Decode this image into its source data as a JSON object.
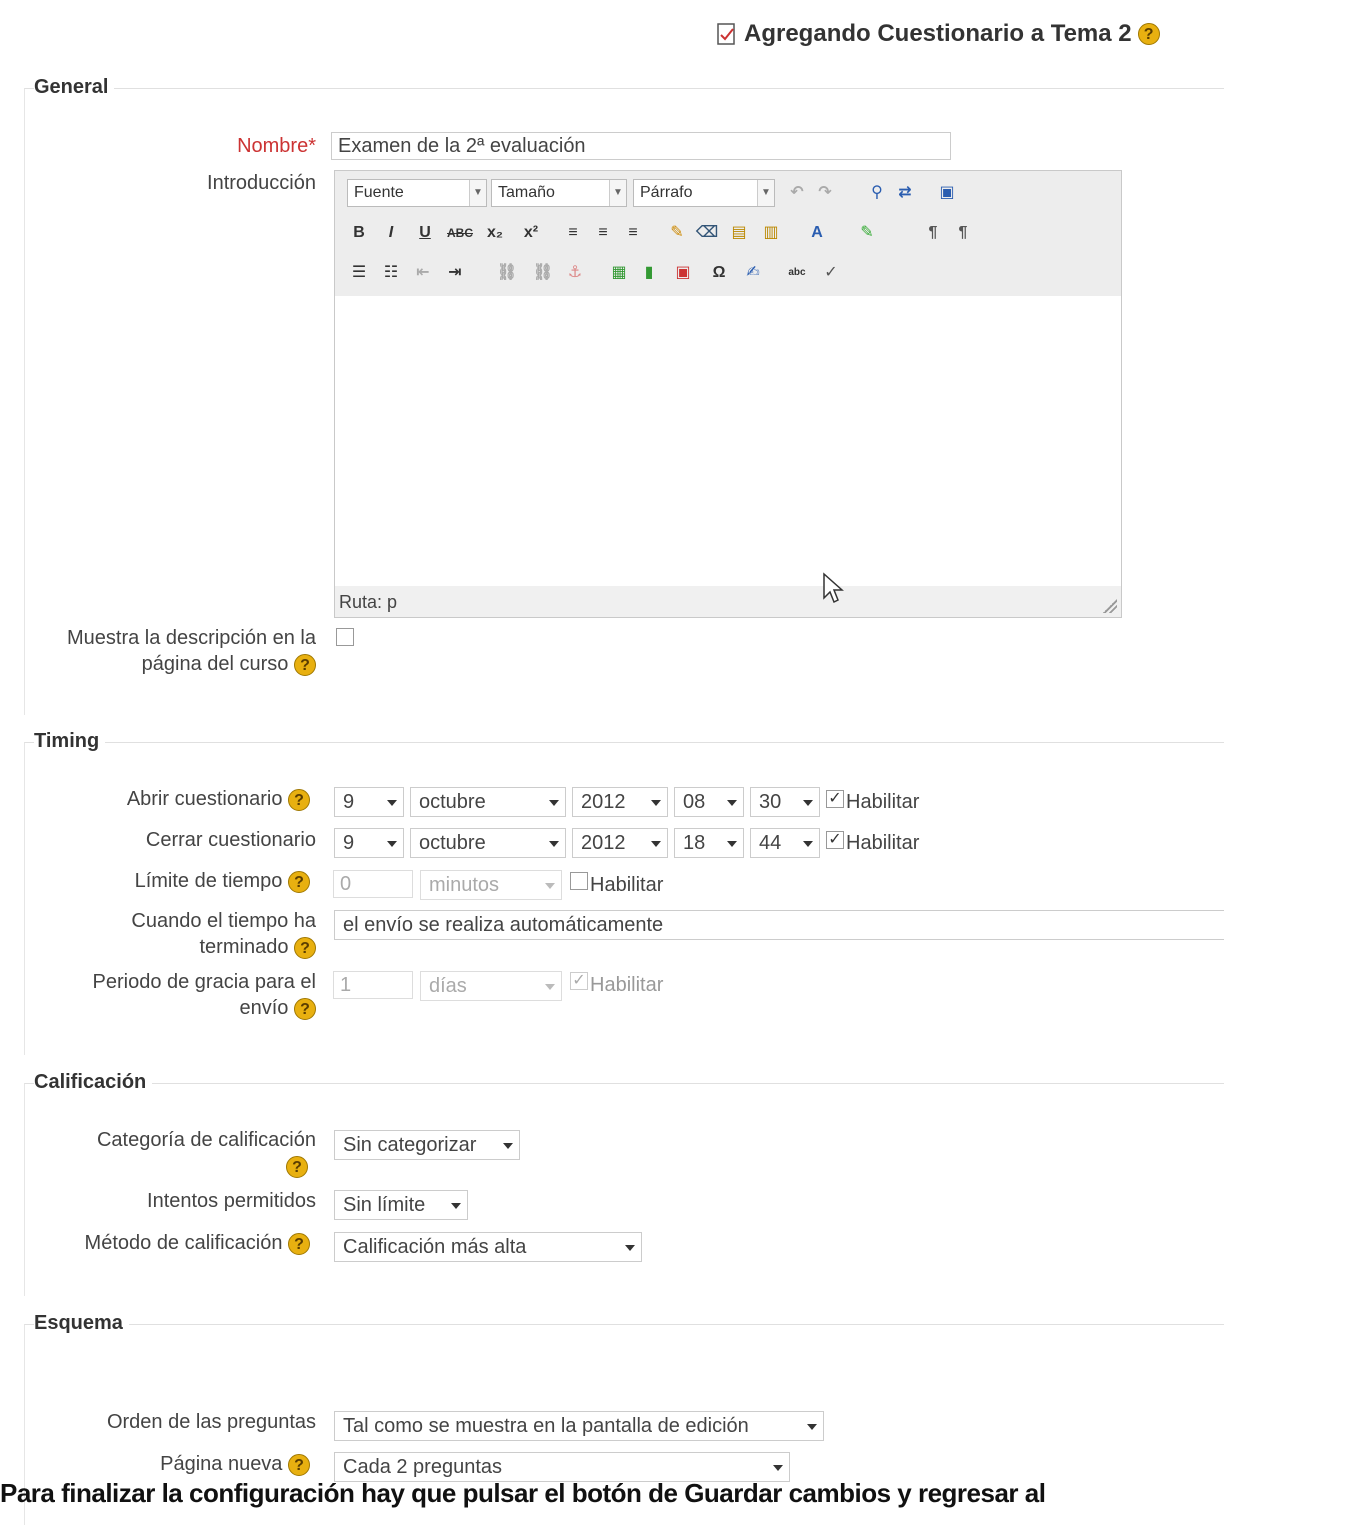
{
  "heading": {
    "icon": "quiz-icon",
    "text": "Agregando Cuestionario a Tema 2"
  },
  "general": {
    "legend": "General",
    "nombre": {
      "label": "Nombre",
      "required_mark": "*",
      "value": "Examen de la 2ª evaluación"
    },
    "introduccion": {
      "label": "Introducción",
      "font_select": "Fuente",
      "size_select": "Tamaño",
      "format_select": "Párrafo",
      "row2": [
        "B",
        "I",
        "U",
        "ABC",
        "x₂",
        "x²"
      ],
      "path_label": "Ruta: p"
    },
    "muestra": {
      "label": "Muestra la descripción en la página del curso",
      "checked": false
    }
  },
  "timing": {
    "legend": "Timing",
    "abrir": {
      "label": "Abrir cuestionario",
      "day": "9",
      "month": "octubre",
      "year": "2012",
      "hour": "08",
      "minute": "30",
      "enable": "Habilitar"
    },
    "cerrar": {
      "label": "Cerrar cuestionario",
      "day": "9",
      "month": "octubre",
      "year": "2012",
      "hour": "18",
      "minute": "44",
      "enable": "Habilitar"
    },
    "limite": {
      "label": "Límite de tiempo",
      "value": "0",
      "unit": "minutos",
      "enable": "Habilitar"
    },
    "cuando": {
      "label": "Cuando el tiempo ha terminado",
      "value": "el envío se realiza automáticamente"
    },
    "gracia": {
      "label": "Periodo de gracia para el envío",
      "value": "1",
      "unit": "días",
      "enable": "Habilitar"
    }
  },
  "calificacion": {
    "legend": "Calificación",
    "categoria": {
      "label": "Categoría de calificación",
      "value": "Sin categorizar"
    },
    "intentos": {
      "label": "Intentos permitidos",
      "value": "Sin límite"
    },
    "metodo": {
      "label": "Método de calificación",
      "value": "Calificación más alta"
    }
  },
  "esquema": {
    "legend": "Esquema",
    "orden": {
      "label": "Orden de las preguntas",
      "value": "Tal como se muestra en la pantalla de edición"
    },
    "pagina": {
      "label": "Página nueva",
      "value": "Cada 2 preguntas"
    }
  },
  "bottom_text": "Para finalizar la configuración hay que pulsar el botón de Guardar cambios y regresar al"
}
